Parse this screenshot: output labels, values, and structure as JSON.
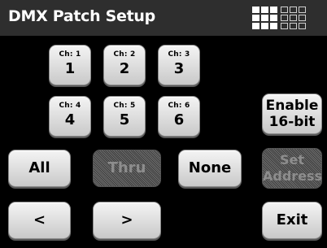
{
  "header": {
    "title": "DMX Patch Setup"
  },
  "channels": [
    {
      "label": "Ch: 1",
      "number": "1"
    },
    {
      "label": "Ch: 2",
      "number": "2"
    },
    {
      "label": "Ch: 3",
      "number": "3"
    },
    {
      "label": "Ch: 4",
      "number": "4"
    },
    {
      "label": "Ch: 5",
      "number": "5"
    },
    {
      "label": "Ch: 6",
      "number": "6"
    }
  ],
  "buttons": {
    "enable_line1": "Enable",
    "enable_line2": "16-bit",
    "all": "All",
    "thru": "Thru",
    "none": "None",
    "set_line1": "Set",
    "set_line2": "Address",
    "prev": "<",
    "next": ">",
    "exit": "Exit"
  },
  "icons": {
    "grid_filled": "grid-3x3-filled-icon",
    "grid_outline": "grid-3x3-outline-icon"
  }
}
